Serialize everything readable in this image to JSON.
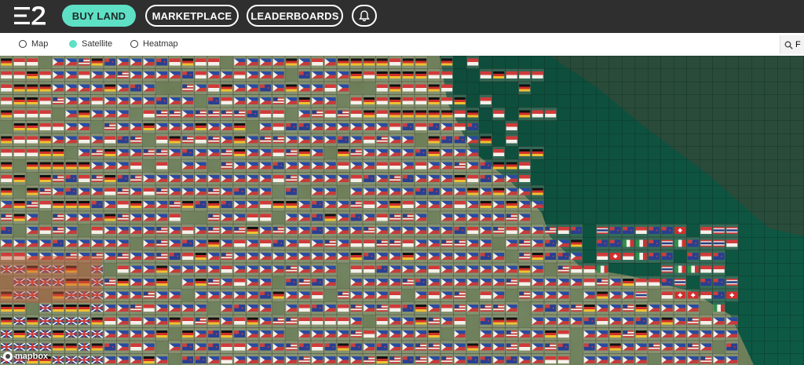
{
  "topbar": {
    "buy_land": "BUY LAND",
    "marketplace": "MARKETPLACE",
    "leaderboards": "LEADERBOARDS",
    "accent_color": "#5ee0c4"
  },
  "layers": {
    "options": [
      {
        "label": "Map",
        "selected": false
      },
      {
        "label": "Satellite",
        "selected": true
      },
      {
        "label": "Heatmap",
        "selected": false
      }
    ]
  },
  "search": {
    "icon": "search-icon",
    "value": "F"
  },
  "map": {
    "attribution": "mapbox",
    "flag_types": [
      "philippines",
      "usa",
      "indonesia",
      "germany",
      "new-zealand",
      "italy",
      "switzerland",
      "uk",
      "thailand"
    ]
  }
}
